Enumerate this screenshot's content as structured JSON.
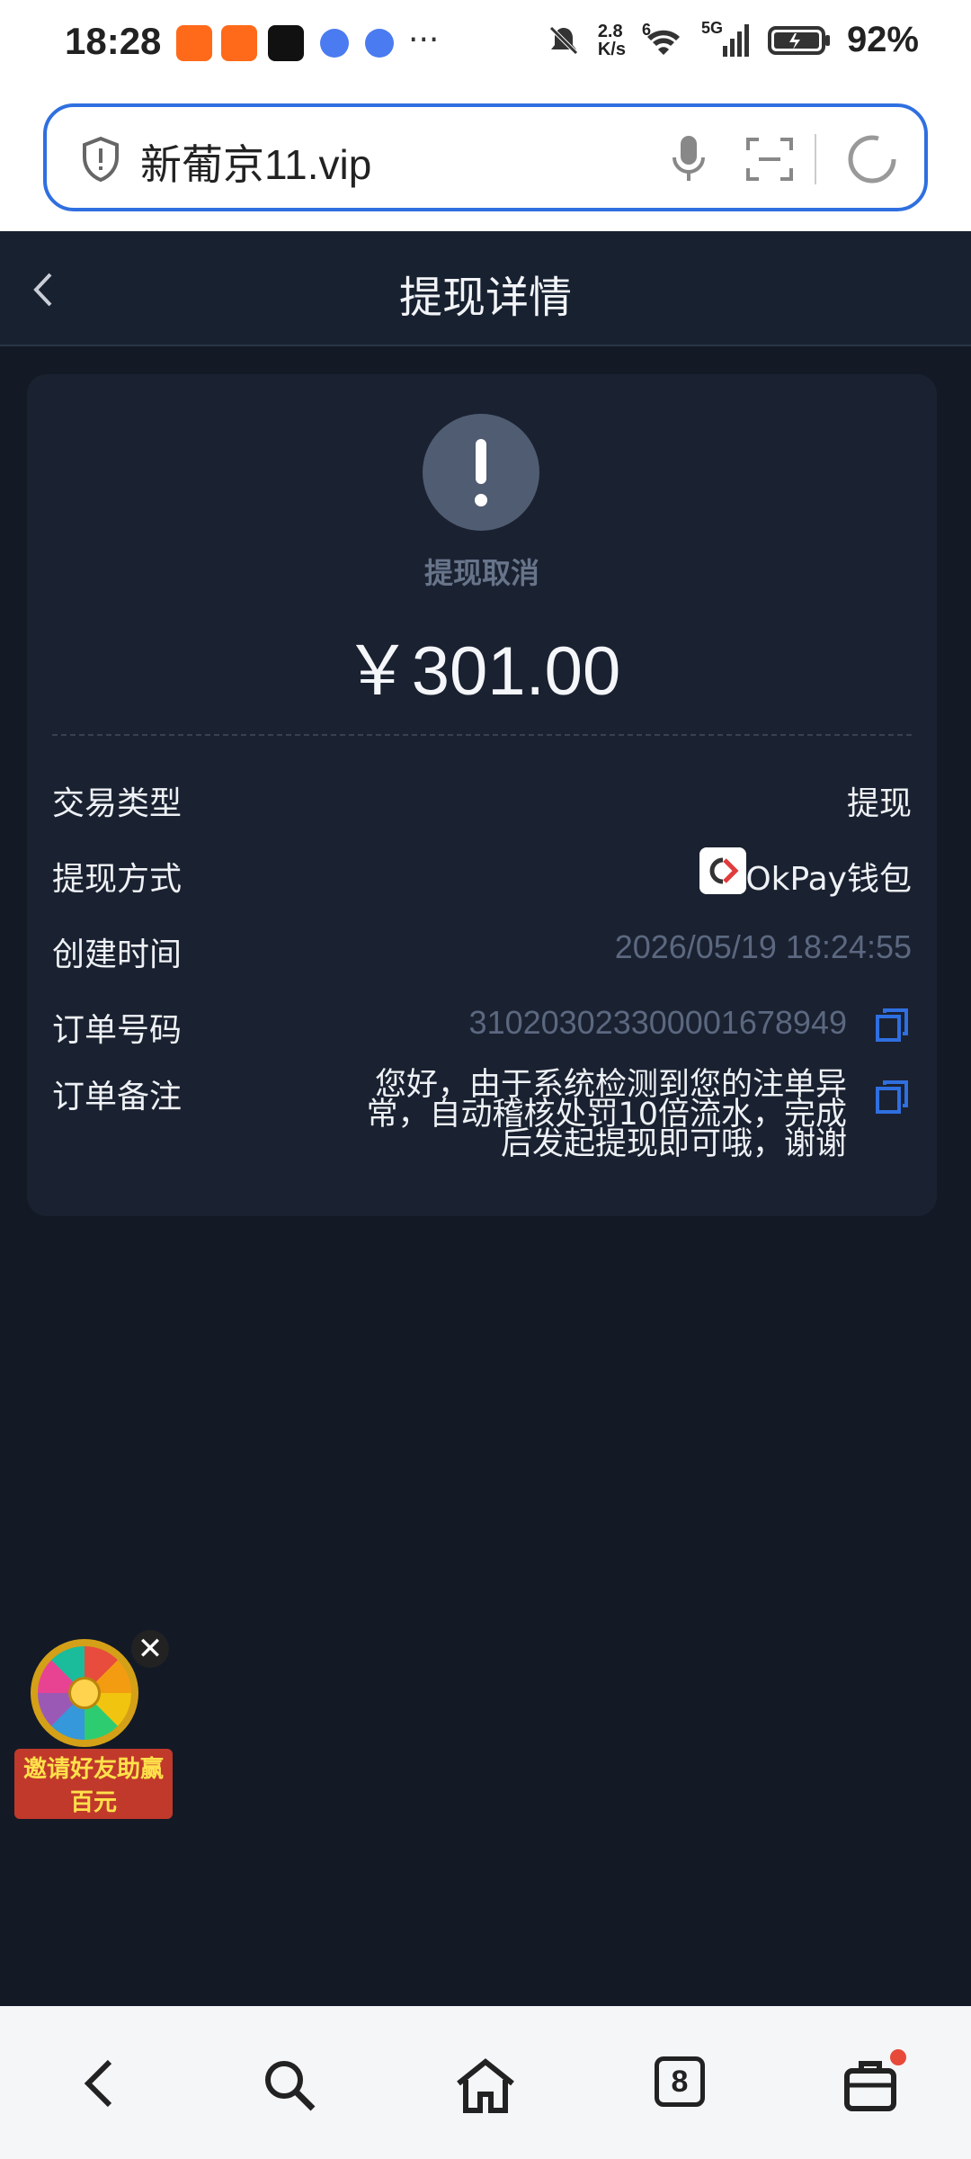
{
  "status_bar": {
    "time": "18:28",
    "speed_top": "2.8",
    "speed_bottom": "K/s",
    "wifi_badge": "6",
    "network": "5G",
    "battery": "92%"
  },
  "browser": {
    "url": "新葡京11.vip"
  },
  "header": {
    "title": "提现详情"
  },
  "detail": {
    "status_text": "提现取消",
    "amount": "￥301.00",
    "rows": [
      {
        "label": "交易类型",
        "value": "提现"
      },
      {
        "label": "提现方式",
        "value": "OkPay钱包"
      },
      {
        "label": "创建时间",
        "value": "2026/05/19 18:24:55"
      },
      {
        "label": "订单号码",
        "value": "310203023300001678949"
      },
      {
        "label": "订单备注",
        "value": "您好，由于系统检测到您的注单异常，自动稽核处罚10倍流水，完成后发起提现即可哦，谢谢"
      }
    ]
  },
  "promo": {
    "text": "邀请好友助赢百元",
    "close": "✕"
  },
  "nav": {
    "tab_count": "8"
  },
  "colors": {
    "page_bg": "#131a26",
    "card_bg": "#1a2130",
    "accent_blue": "#2f6fe0",
    "muted_gray": "#5b6880"
  }
}
